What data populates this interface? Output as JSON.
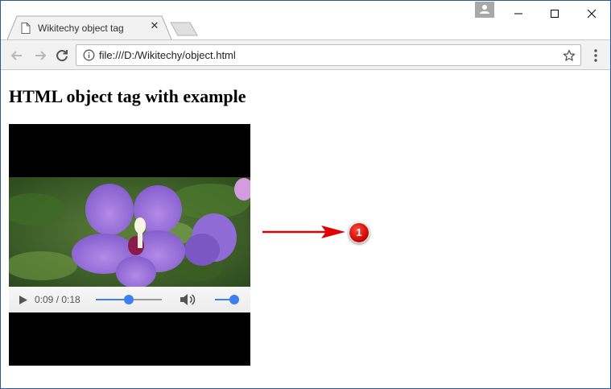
{
  "browser": {
    "tab": {
      "title": "Wikitechy object tag",
      "close_glyph": "✕",
      "icon": "document-icon"
    },
    "new_tab_icon": "new-tab-icon",
    "window_controls": [
      "minimize-icon",
      "maximize-icon",
      "close-icon"
    ],
    "profile_icon": "profile-icon",
    "toolbar": {
      "icons": [
        "back-arrow-icon",
        "forward-arrow-icon",
        "reload-icon",
        "info-icon",
        "star-icon",
        "more-menu-icon"
      ],
      "url": "file:///D:/Wikitechy/object.html"
    }
  },
  "page": {
    "heading": "HTML object tag with example",
    "video": {
      "subject": "purple hibiscus flower",
      "current_time": "0:09",
      "separator": " / ",
      "duration": "0:18",
      "progress_fraction": 0.5,
      "volume_fraction": 0.85,
      "controls_icons": [
        "play-icon",
        "volume-icon"
      ]
    },
    "annotation": {
      "label": "1",
      "arrow_color": "#e00000"
    }
  },
  "colors": {
    "accent": "#3d7ff0",
    "window_border": "#2b5797",
    "callout_red": "#d40000"
  }
}
